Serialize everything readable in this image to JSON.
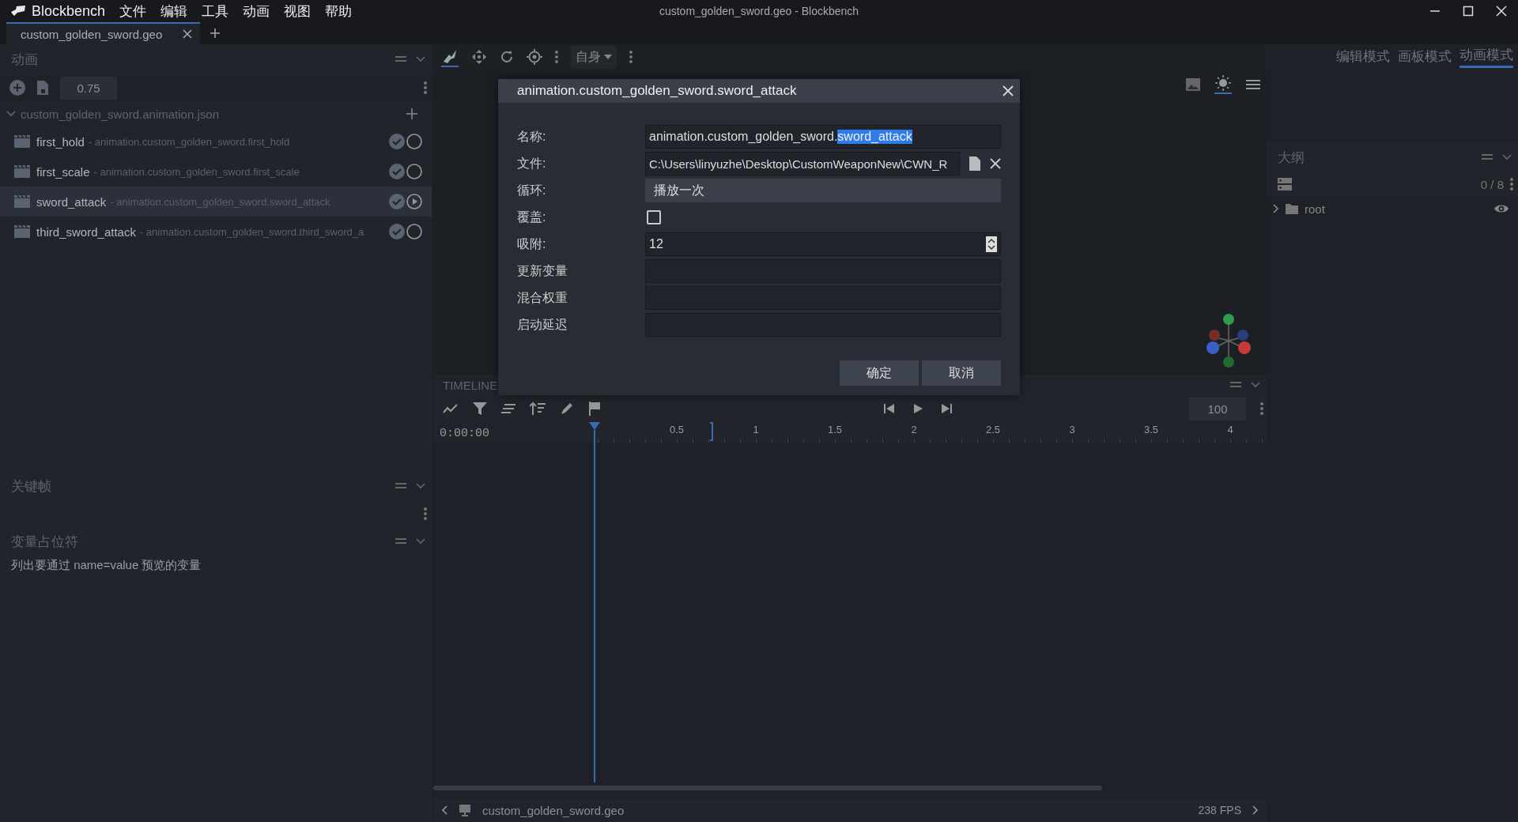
{
  "app": {
    "name": "Blockbench",
    "menu": [
      "文件",
      "编辑",
      "工具",
      "动画",
      "视图",
      "帮助"
    ],
    "title": "custom_golden_sword.geo - Blockbench"
  },
  "tabs": [
    {
      "label": "custom_golden_sword.geo",
      "selected": true
    }
  ],
  "animations_panel": {
    "title": "动画",
    "speed": "0.75",
    "file": "custom_golden_sword.animation.json",
    "items": [
      {
        "name": "first_hold",
        "path": "- animation.custom_golden_sword.first_hold",
        "selected": false,
        "playing": false
      },
      {
        "name": "first_scale",
        "path": "- animation.custom_golden_sword.first_scale",
        "selected": false,
        "playing": false
      },
      {
        "name": "sword_attack",
        "path": "- animation.custom_golden_sword.sword_attack",
        "selected": true,
        "playing": true
      },
      {
        "name": "third_sword_attack",
        "path": "- animation.custom_golden_sword.third_sword_a",
        "selected": false,
        "playing": false
      }
    ]
  },
  "keyframe_panel": {
    "title": "关键帧"
  },
  "variables_panel": {
    "title": "变量占位符",
    "hint": "列出要通过 name=value 预览的变量"
  },
  "toolbar": {
    "space": "自身"
  },
  "modes": [
    {
      "label": "编辑模式",
      "selected": false
    },
    {
      "label": "画板模式",
      "selected": false
    },
    {
      "label": "动画模式",
      "selected": true
    }
  ],
  "outliner": {
    "title": "大纲",
    "count": "0 / 8",
    "items": [
      {
        "name": "root",
        "expanded": false
      }
    ]
  },
  "timeline": {
    "title": "TIMELINE",
    "time": "0:00:00",
    "zoom": "100",
    "ticks": [
      "0.5",
      "1",
      "1.5",
      "2",
      "2.5",
      "3",
      "3.5",
      "4"
    ]
  },
  "status": {
    "file": "custom_golden_sword.geo",
    "fps": "238 FPS"
  },
  "dialog": {
    "title": "animation.custom_golden_sword.sword_attack",
    "fields": [
      {
        "kind": "text",
        "label": "名称:",
        "value": "animation.custom_golden_sword.",
        "selected_text": "sword_attack"
      },
      {
        "kind": "file",
        "label": "文件:",
        "value": "C:\\Users\\linyuzhe\\Desktop\\CustomWeaponNew\\CWN_R"
      },
      {
        "kind": "select",
        "label": "循环:",
        "value": "播放一次"
      },
      {
        "kind": "checkbox",
        "label": "覆盖:",
        "checked": false
      },
      {
        "kind": "number",
        "label": "吸附:",
        "value": "12"
      },
      {
        "kind": "text",
        "label": "更新变量"
      },
      {
        "kind": "text",
        "label": "混合权重"
      },
      {
        "kind": "text",
        "label": "启动延迟"
      }
    ],
    "buttons": [
      "确定",
      "取消"
    ]
  }
}
